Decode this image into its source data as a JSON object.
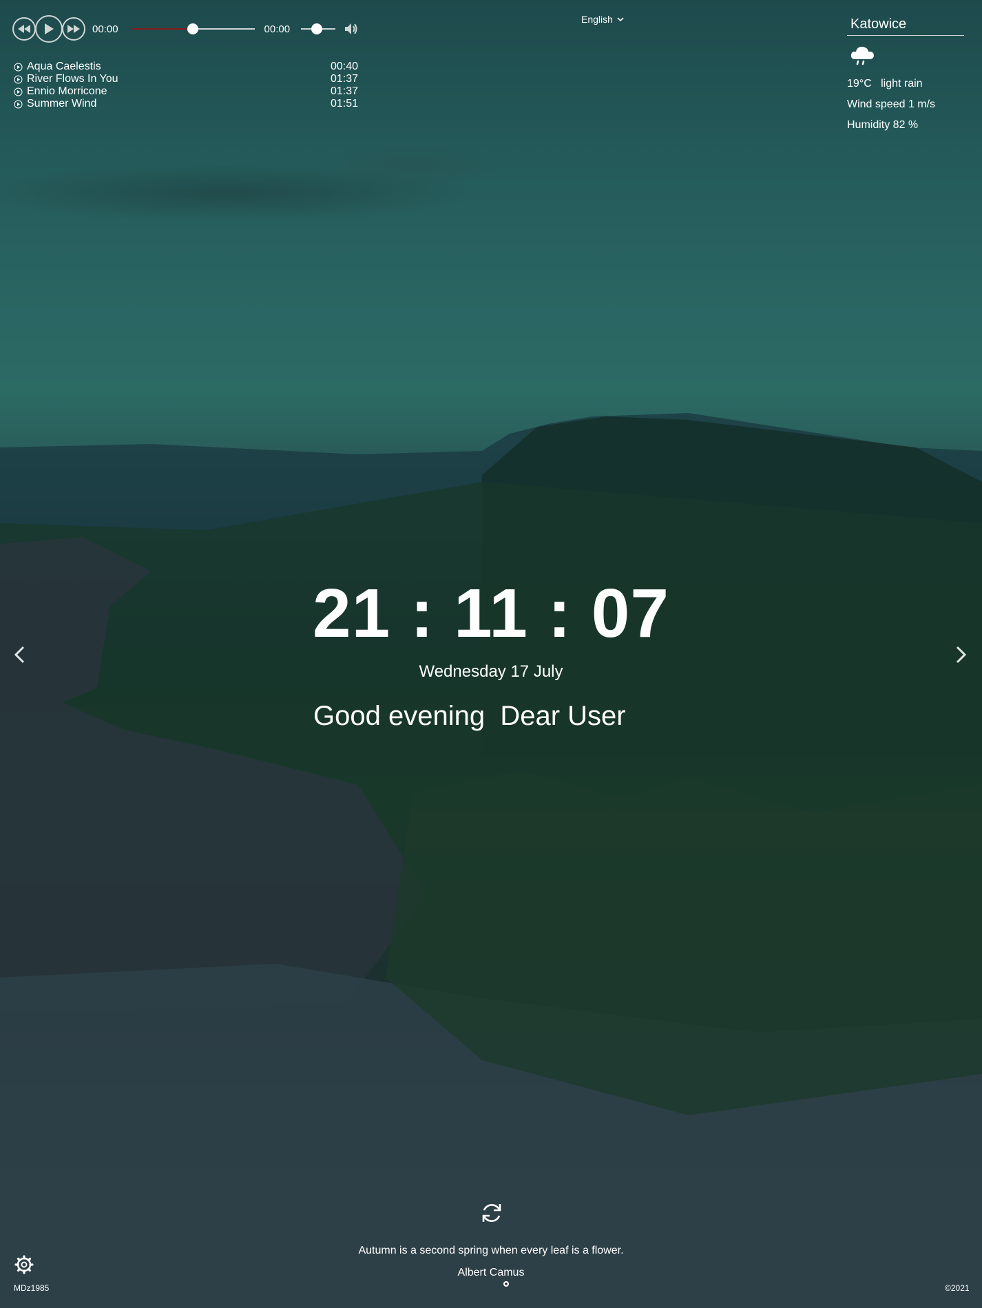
{
  "player": {
    "current_time": "00:00",
    "duration": "00:00",
    "progress_fraction": 0.5,
    "volume_fraction": 0.45
  },
  "playlist": [
    {
      "title": "Aqua Caelestis",
      "time": "00:40"
    },
    {
      "title": "River Flows In You",
      "time": "01:37"
    },
    {
      "title": "Ennio Morricone",
      "time": "01:37"
    },
    {
      "title": "Summer Wind",
      "time": "01:51"
    }
  ],
  "language": {
    "selected": "English"
  },
  "weather": {
    "city": "Katowice",
    "icon": "rain-cloud-icon",
    "temperature": "19°C",
    "description": "light rain",
    "wind": "Wind speed 1 m/s",
    "humidity": "Humidity 82 %"
  },
  "clock": {
    "time": "21 : 11 : 07"
  },
  "date": {
    "text": "Wednesday 17 July"
  },
  "greeting": {
    "text": "Good evening",
    "name": "Dear User"
  },
  "quote": {
    "text": "Autumn is a second spring when every leaf is a flower.",
    "author": "Albert Camus"
  },
  "footer": {
    "author": "MDz1985",
    "copyright": "©2021"
  },
  "colors": {
    "progress_fill": "#8b1a1a",
    "text": "#ffffff"
  }
}
